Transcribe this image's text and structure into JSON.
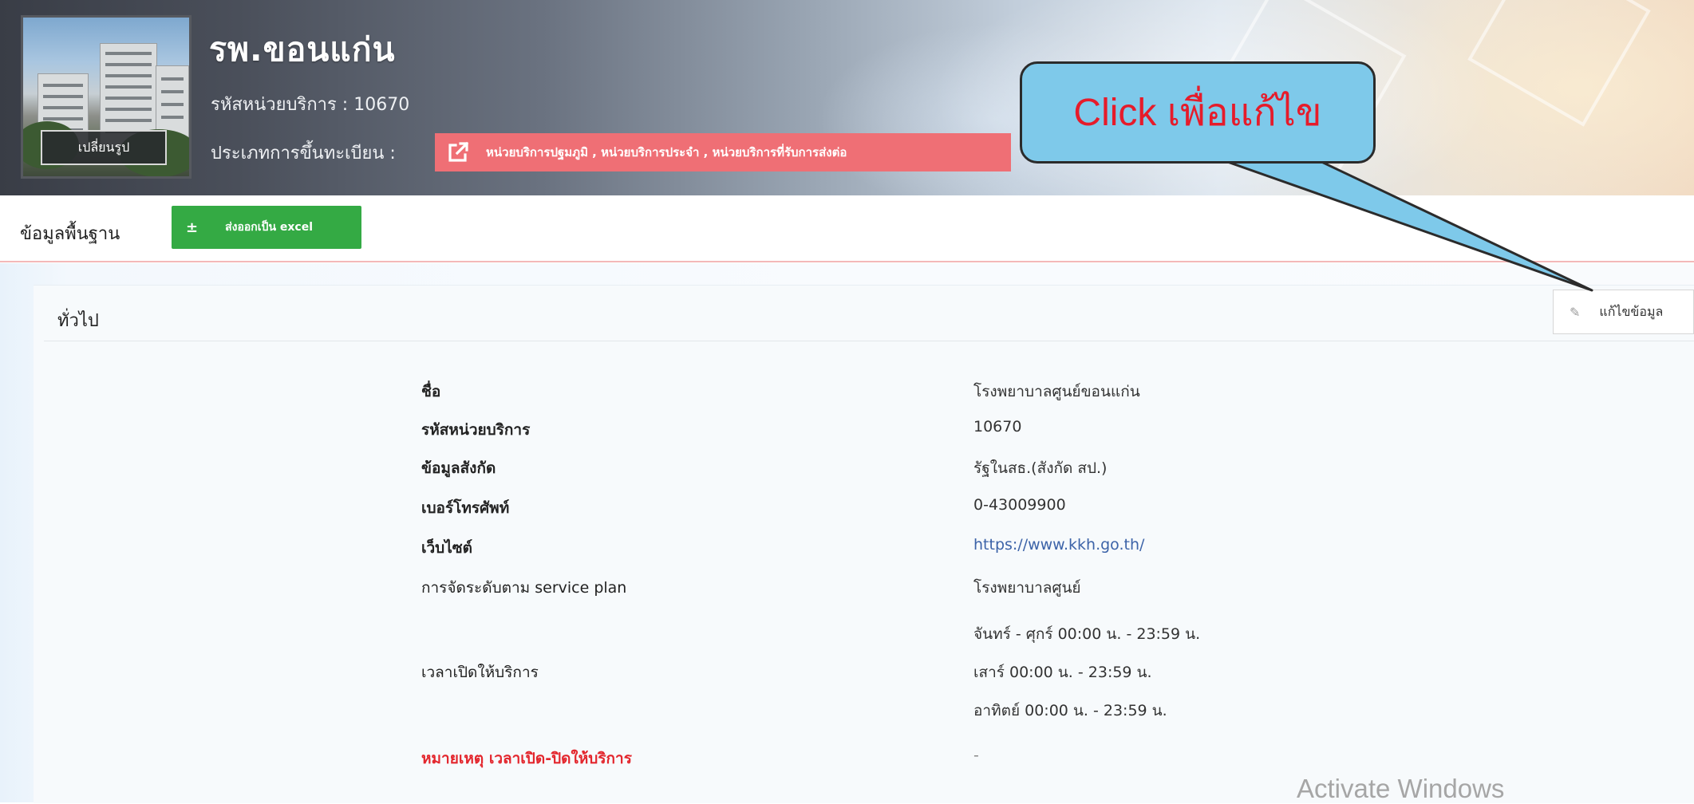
{
  "header": {
    "hospital_name": "รพ.ขอนแก่น",
    "service_code_label": "รหัสหน่วยบริการ : 10670",
    "registration_type_label": "ประเภทการขึ้นทะเบียน :",
    "registration_types": "หน่วยบริการปฐมภูมิ , หน่วยบริการประจำ , หน่วยบริการที่รับการส่งต่อ",
    "change_photo_label": "เปลี่ยนรูป"
  },
  "callout": {
    "text": "Click เพื่อแก้ไข"
  },
  "toolbar": {
    "section_title": "ข้อมูลพื้นฐาน",
    "export_label": "ส่งออกเป็น excel",
    "export_icon": "download-icon"
  },
  "panel": {
    "title": "ทั่วไป",
    "edit_label": "แก้ไขข้อมูล",
    "edit_icon": "wrench-icon"
  },
  "fields": {
    "name_label": "ชื่อ",
    "name_value": "โรงพยาบาลศูนย์ขอนแก่น",
    "code_label": "รหัสหน่วยบริการ",
    "code_value": "10670",
    "affiliation_label": "ข้อมูลสังกัด",
    "affiliation_value": "รัฐในสธ.(สังกัด สป.)",
    "phone_label": "เบอร์โทรศัพท์",
    "phone_value": "0-43009900",
    "website_label": "เว็บไซต์",
    "website_value": "https://www.kkh.go.th/",
    "service_plan_label": "การจัดระดับตาม service plan",
    "service_plan_value": "โรงพยาบาลศูนย์",
    "hours_label": "เวลาเปิดให้บริการ",
    "hours_weekday": "จันทร์ - ศุกร์ 00:00 น. - 23:59 น.",
    "hours_saturday": "เสาร์ 00:00 น. - 23:59 น.",
    "hours_sunday": "อาทิตย์ 00:00 น. - 23:59 น.",
    "note_label": "หมายเหตุ เวลาเปิด-ปิดให้บริการ",
    "note_value": "-"
  },
  "watermark": "Activate Windows",
  "colors": {
    "export_button": "#34aa44",
    "type_badge": "#ef6f75",
    "callout_fill": "#7ec9ea",
    "callout_text": "#e61b2a",
    "note_label": "#e3262d",
    "link": "#3c63a8"
  }
}
